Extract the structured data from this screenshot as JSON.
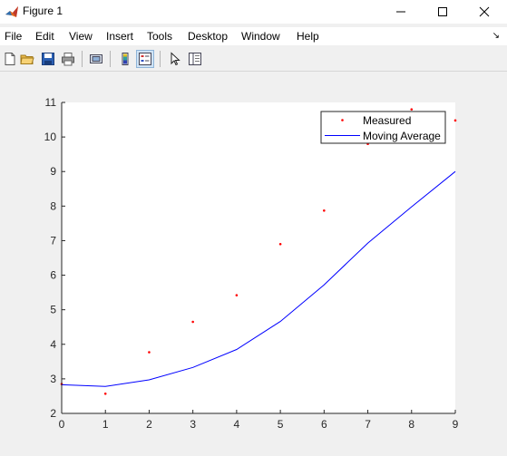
{
  "window": {
    "title": "Figure 1"
  },
  "menubar": {
    "items": [
      "File",
      "Edit",
      "View",
      "Insert",
      "Tools",
      "Desktop",
      "Window",
      "Help"
    ]
  },
  "toolbar": {
    "buttons": [
      "new-figure-icon",
      "open-file-icon",
      "save-figure-icon",
      "print-figure-icon",
      "link-plot-icon",
      "insert-colorbar-icon",
      "insert-legend-icon",
      "edit-plot-icon",
      "property-inspector-icon"
    ],
    "selected": "insert-legend-icon"
  },
  "chart_data": {
    "type": "line",
    "x": [
      0,
      1,
      2,
      3,
      4,
      5,
      6,
      7,
      8,
      9
    ],
    "series": [
      {
        "name": "Measured",
        "style": "markers",
        "color": "#ff0000",
        "values": [
          2.85,
          2.57,
          3.77,
          4.65,
          5.42,
          6.9,
          7.87,
          9.8,
          10.8,
          10.48
        ]
      },
      {
        "name": "Moving Average",
        "style": "line",
        "color": "#0000ff",
        "values": [
          2.83,
          2.78,
          2.97,
          3.33,
          3.85,
          4.66,
          5.72,
          6.93,
          7.98,
          9.0
        ]
      }
    ],
    "xlim": [
      0,
      9
    ],
    "ylim": [
      2,
      11
    ],
    "xticks": [
      0,
      1,
      2,
      3,
      4,
      5,
      6,
      7,
      8,
      9
    ],
    "yticks": [
      2,
      3,
      4,
      5,
      6,
      7,
      8,
      9,
      10,
      11
    ],
    "legend": {
      "position": "top-right"
    },
    "grid": false
  }
}
